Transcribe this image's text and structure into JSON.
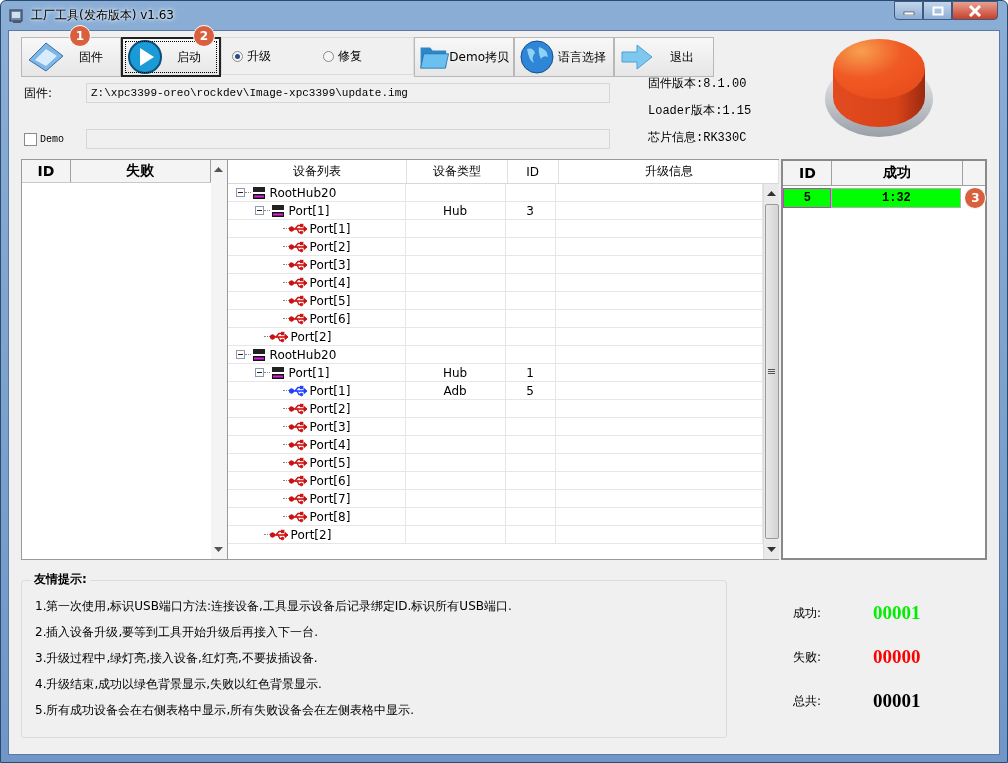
{
  "window": {
    "title": "工厂工具(发布版本) v1.63"
  },
  "toolbar": [
    {
      "kind": "firmware",
      "label": "固件",
      "callout": "1",
      "focused": false
    },
    {
      "kind": "start",
      "label": "启动",
      "callout": "2",
      "focused": true
    },
    {
      "kind": "modes",
      "options": [
        {
          "label": "升级",
          "selected": true
        },
        {
          "label": "修复",
          "selected": false
        }
      ]
    },
    {
      "kind": "folder",
      "label": "Demo拷贝",
      "focused": false
    },
    {
      "kind": "globe",
      "label": "语言选择",
      "focused": false
    },
    {
      "kind": "exit",
      "label": "退出",
      "focused": false
    }
  ],
  "firmware": {
    "label": "固件:",
    "value": "Z:\\xpc3399-oreo\\rockdev\\Image-xpc3399\\update.img"
  },
  "demo": {
    "label": "Demo",
    "checked": false
  },
  "info": [
    "固件版本:8.1.00",
    "Loader版本:1.15",
    "芯片信息:RK330C"
  ],
  "fail_table": {
    "columns": [
      "ID",
      "失败"
    ]
  },
  "device_tree": {
    "columns": [
      "设备列表",
      "设备类型",
      "ID",
      "升级信息"
    ],
    "nodes": [
      {
        "kind": "hub",
        "name": "RootHub20",
        "expanded": true,
        "children": [
          {
            "kind": "hub",
            "name": "Port[1]",
            "type": "Hub",
            "id": "3",
            "expanded": true,
            "children": [
              {
                "kind": "port",
                "name": "Port[1]",
                "connected": false
              },
              {
                "kind": "port",
                "name": "Port[2]",
                "connected": false
              },
              {
                "kind": "port",
                "name": "Port[3]",
                "connected": false
              },
              {
                "kind": "port",
                "name": "Port[4]",
                "connected": false
              },
              {
                "kind": "port",
                "name": "Port[5]",
                "connected": false
              },
              {
                "kind": "port",
                "name": "Port[6]",
                "connected": false
              }
            ]
          },
          {
            "kind": "port",
            "name": "Port[2]",
            "connected": false
          }
        ]
      },
      {
        "kind": "hub",
        "name": "RootHub20",
        "expanded": true,
        "children": [
          {
            "kind": "hub",
            "name": "Port[1]",
            "type": "Hub",
            "id": "1",
            "expanded": true,
            "children": [
              {
                "kind": "port",
                "name": "Port[1]",
                "type": "Adb",
                "id": "5",
                "connected": true
              },
              {
                "kind": "port",
                "name": "Port[2]",
                "connected": false
              },
              {
                "kind": "port",
                "name": "Port[3]",
                "connected": false
              },
              {
                "kind": "port",
                "name": "Port[4]",
                "connected": false
              },
              {
                "kind": "port",
                "name": "Port[5]",
                "connected": false
              },
              {
                "kind": "port",
                "name": "Port[6]",
                "connected": false
              },
              {
                "kind": "port",
                "name": "Port[7]",
                "connected": false
              },
              {
                "kind": "port",
                "name": "Port[8]",
                "connected": false
              }
            ]
          },
          {
            "kind": "port",
            "name": "Port[2]",
            "connected": false
          }
        ]
      }
    ]
  },
  "success_table": {
    "columns": [
      "ID",
      "成功"
    ],
    "rows": [
      {
        "id": "5",
        "time": "1:32",
        "callout": "3"
      }
    ]
  },
  "tips": {
    "title": "友情提示:",
    "lines": [
      "1.第一次使用,标识USB端口方法:连接设备,工具显示设备后记录绑定ID.标识所有USB端口.",
      "2.插入设备升级,要等到工具开始升级后再接入下一台.",
      "3.升级过程中,绿灯亮,接入设备,红灯亮,不要拔插设备.",
      "4.升级结束,成功以绿色背景显示,失败以红色背景显示.",
      "5.所有成功设备会在右侧表格中显示,所有失败设备会在左侧表格中显示."
    ]
  },
  "stats": [
    {
      "kind": "success",
      "label": "成功:",
      "value": "00001"
    },
    {
      "kind": "fail",
      "label": "失败:",
      "value": "00000"
    },
    {
      "kind": "total",
      "label": "总共:",
      "value": "00001"
    }
  ]
}
